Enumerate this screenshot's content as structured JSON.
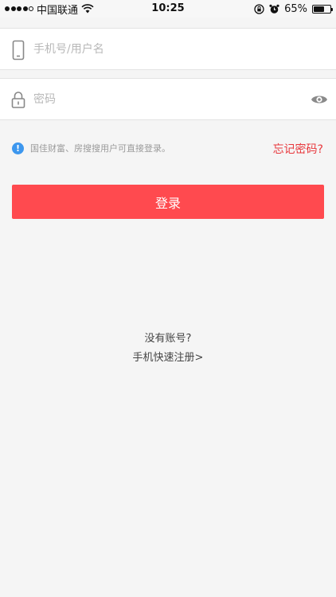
{
  "status_bar": {
    "carrier": "中国联通",
    "time": "10:25",
    "battery": "65%",
    "battery_level": 0.65,
    "signal_icon": "signal-dots-icon",
    "wifi_icon": "wifi-icon",
    "rotation_lock_icon": "rotation-lock-icon",
    "alarm_icon": "alarm-icon"
  },
  "form": {
    "username_placeholder": "手机号/用户名",
    "username_value": "",
    "password_placeholder": "密码",
    "password_value": "",
    "phone_icon": "phone-icon",
    "lock_icon": "lock-icon",
    "show_password_icon": "eye-icon"
  },
  "notice": {
    "icon": "info-icon",
    "icon_glyph": "!",
    "text": "国佳财富、房搜搜用户可直接登录。"
  },
  "forgot_password": "忘记密码?",
  "login_button": "登录",
  "register": {
    "prompt": "没有账号?",
    "link": "手机快速注册>"
  },
  "colors": {
    "accent": "#ff4a4f",
    "link_red": "#e8373c",
    "info_blue": "#3d97ee",
    "background": "#f5f5f5"
  }
}
